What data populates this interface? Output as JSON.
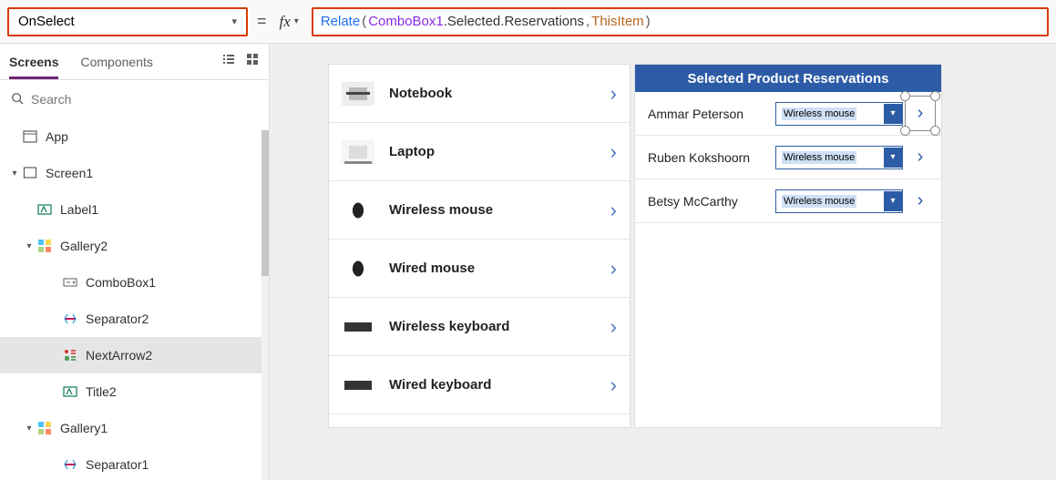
{
  "property": {
    "name": "OnSelect",
    "formula_tokens": [
      {
        "t": "Relate",
        "c": "fn"
      },
      {
        "t": "( ",
        "c": "punc"
      },
      {
        "t": "ComboBox1",
        "c": "id"
      },
      {
        "t": ".Selected.Reservations",
        "c": "prop"
      },
      {
        "t": ", ",
        "c": "punc"
      },
      {
        "t": "ThisItem",
        "c": "this"
      },
      {
        "t": " )",
        "c": "punc"
      }
    ]
  },
  "sidebar": {
    "tabs": {
      "screens": "Screens",
      "components": "Components"
    },
    "search_placeholder": "Search",
    "tree": [
      {
        "depth": 0,
        "chevron": "none",
        "icon": "app",
        "label": "App"
      },
      {
        "depth": 0,
        "chevron": "down",
        "icon": "screen",
        "label": "Screen1"
      },
      {
        "depth": 1,
        "chevron": "none",
        "icon": "label",
        "label": "Label1"
      },
      {
        "depth": 1,
        "chevron": "down",
        "icon": "gallery",
        "label": "Gallery2"
      },
      {
        "depth": 2,
        "chevron": "none",
        "icon": "combobox",
        "label": "ComboBox1"
      },
      {
        "depth": 2,
        "chevron": "none",
        "icon": "separator",
        "label": "Separator2"
      },
      {
        "depth": 2,
        "chevron": "none",
        "icon": "nextarrow",
        "label": "NextArrow2",
        "selected": true
      },
      {
        "depth": 2,
        "chevron": "none",
        "icon": "label",
        "label": "Title2"
      },
      {
        "depth": 1,
        "chevron": "down",
        "icon": "gallery",
        "label": "Gallery1"
      },
      {
        "depth": 2,
        "chevron": "none",
        "icon": "separator",
        "label": "Separator1"
      }
    ]
  },
  "canvas": {
    "products": [
      {
        "label": "Notebook",
        "thumb": "notebook"
      },
      {
        "label": "Laptop",
        "thumb": "laptop"
      },
      {
        "label": "Wireless mouse",
        "thumb": "mouse"
      },
      {
        "label": "Wired mouse",
        "thumb": "mouse"
      },
      {
        "label": "Wireless keyboard",
        "thumb": "kbd"
      },
      {
        "label": "Wired keyboard",
        "thumb": "kbd"
      }
    ],
    "reservations_title": "Selected Product Reservations",
    "reservations": [
      {
        "name": "Ammar Peterson",
        "combo": "Wireless mouse",
        "selected_arrow": true
      },
      {
        "name": "Ruben Kokshoorn",
        "combo": "Wireless mouse"
      },
      {
        "name": "Betsy McCarthy",
        "combo": "Wireless mouse"
      }
    ]
  }
}
